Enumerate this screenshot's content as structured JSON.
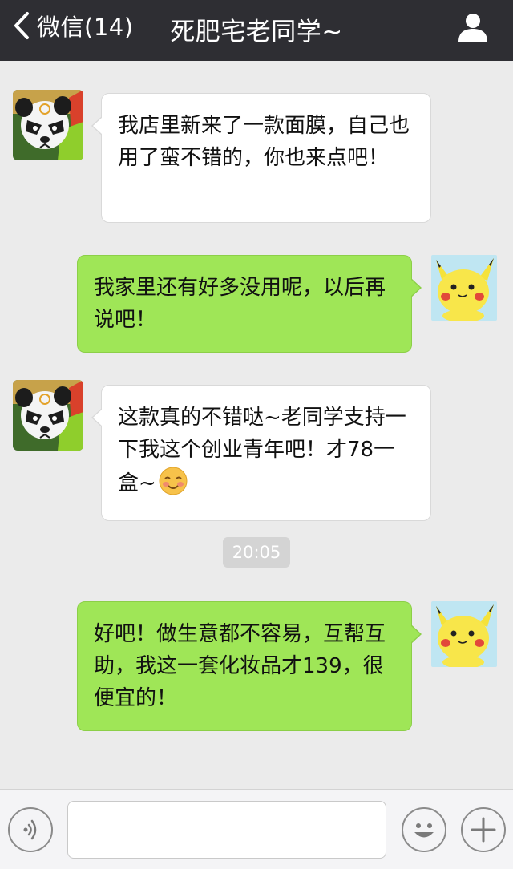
{
  "header": {
    "back_label": "微信(14)",
    "title": "死肥宅老同学~"
  },
  "messages": [
    {
      "direction": "incoming",
      "avatar": "panda-avatar",
      "text": "我店里新来了一款面膜，自己也用了蛮不错的，你也来点吧！"
    },
    {
      "direction": "outgoing",
      "avatar": "pikachu-avatar",
      "text": "我家里还有好多没用呢，以后再说吧！"
    },
    {
      "direction": "incoming",
      "avatar": "panda-avatar",
      "text": "这款真的不错哒~老同学支持一下我这个创业青年吧！才78一盒~",
      "emoji": "blushing-smile-emoji"
    },
    {
      "direction": "outgoing",
      "avatar": "pikachu-avatar",
      "text": "好吧！做生意都不容易，互帮互助，我这一套化妆品才139，很便宜的！"
    }
  ],
  "timestamp": "20:05",
  "input": {
    "value": "",
    "placeholder": ""
  },
  "icons": {
    "back": "chevron-left-icon",
    "profile": "person-icon",
    "voice": "voice-icon",
    "emoji": "emoji-face-icon",
    "plus": "plus-icon"
  },
  "colors": {
    "header_bg": "#2e2e33",
    "chat_bg": "#ebebeb",
    "incoming_bubble": "#ffffff",
    "outgoing_bubble": "#9fe657"
  }
}
